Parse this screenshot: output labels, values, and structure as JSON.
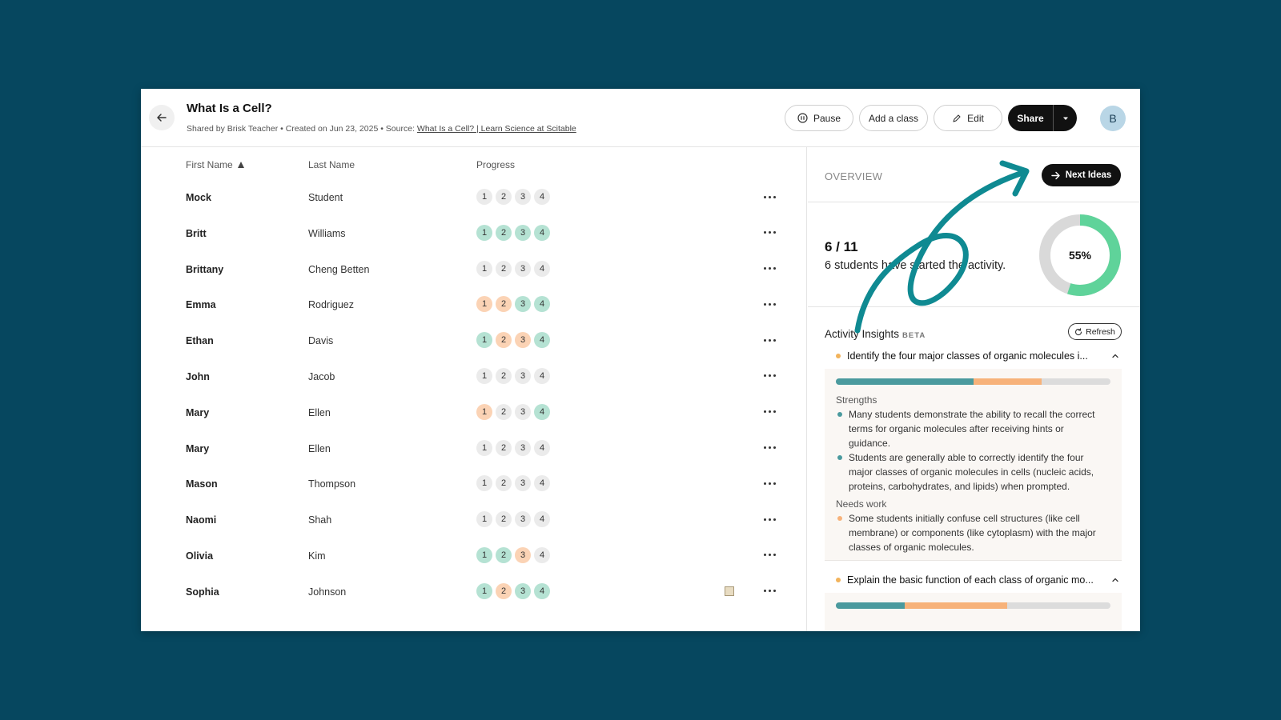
{
  "header": {
    "title": "What Is a Cell?",
    "meta_prefix": "Shared by Brisk Teacher • Created on Jun 23, 2025 • Source: ",
    "source_link": "What Is a Cell? | Learn Science at Scitable",
    "pause_label": "Pause",
    "add_class_label": "Add a class",
    "edit_label": "Edit",
    "share_label": "Share",
    "avatar_initial": "B"
  },
  "table": {
    "columns": {
      "first": "First Name",
      "last": "Last Name",
      "progress": "Progress"
    },
    "steps": [
      "1",
      "2",
      "3",
      "4"
    ],
    "rows": [
      {
        "first": "Mock",
        "last": "Student",
        "progress": [
          "none",
          "none",
          "none",
          "none"
        ],
        "note": false
      },
      {
        "first": "Britt",
        "last": "Williams",
        "progress": [
          "correct",
          "correct",
          "correct",
          "correct"
        ],
        "note": false
      },
      {
        "first": "Brittany",
        "last": "Cheng Betten",
        "progress": [
          "none",
          "none",
          "none",
          "none"
        ],
        "note": false
      },
      {
        "first": "Emma",
        "last": "Rodriguez",
        "progress": [
          "partial",
          "partial",
          "correct",
          "correct"
        ],
        "note": false
      },
      {
        "first": "Ethan",
        "last": "Davis",
        "progress": [
          "correct",
          "partial",
          "partial",
          "correct"
        ],
        "note": false
      },
      {
        "first": "John",
        "last": "Jacob",
        "progress": [
          "none",
          "none",
          "none",
          "none"
        ],
        "note": false
      },
      {
        "first": "Mary",
        "last": "Ellen",
        "progress": [
          "partial",
          "none",
          "none",
          "correct"
        ],
        "note": false
      },
      {
        "first": "Mary",
        "last": "Ellen",
        "progress": [
          "none",
          "none",
          "none",
          "none"
        ],
        "note": false
      },
      {
        "first": "Mason",
        "last": "Thompson",
        "progress": [
          "none",
          "none",
          "none",
          "none"
        ],
        "note": false
      },
      {
        "first": "Naomi",
        "last": "Shah",
        "progress": [
          "none",
          "none",
          "none",
          "none"
        ],
        "note": false
      },
      {
        "first": "Olivia",
        "last": "Kim",
        "progress": [
          "correct",
          "correct",
          "partial",
          "none"
        ],
        "note": false
      },
      {
        "first": "Sophia",
        "last": "Johnson",
        "progress": [
          "correct",
          "partial",
          "correct",
          "correct"
        ],
        "note": true
      }
    ]
  },
  "overview": {
    "label": "OVERVIEW",
    "next_ideas_label": "Next Ideas",
    "count": "6 / 11",
    "count_text": "6 students have started the activity.",
    "percent_label": "55%",
    "percent_value": 0.55
  },
  "insights": {
    "title": "Activity Insights",
    "beta": "BETA",
    "refresh_label": "Refresh",
    "items": [
      {
        "heading": "Identify the four major classes of organic molecules i...",
        "bar": {
          "green": 0.5,
          "orange": 0.25
        },
        "strengths_label": "Strengths",
        "strengths": [
          "Many students demonstrate the ability to recall the correct terms for organic molecules after receiving hints or guidance.",
          "Students are generally able to correctly identify the four major classes of organic molecules in cells (nucleic acids, proteins, carbohydrates, and lipids) when prompted."
        ],
        "needs_label": "Needs work",
        "needs": [
          "Some students initially confuse cell structures (like cell membrane) or components (like cytoplasm) with the major classes of organic molecules."
        ]
      },
      {
        "heading": "Explain the basic function of each class of organic mo...",
        "bar": {
          "green": 0.25,
          "orange": 0.375
        }
      }
    ]
  },
  "colors": {
    "background": "#06475f",
    "correct": "#b5e2d3",
    "partial": "#fbd3b5",
    "donut_fill": "#5fd39a",
    "donut_track": "#d9d9d9",
    "annotation": "#0f8a92"
  }
}
